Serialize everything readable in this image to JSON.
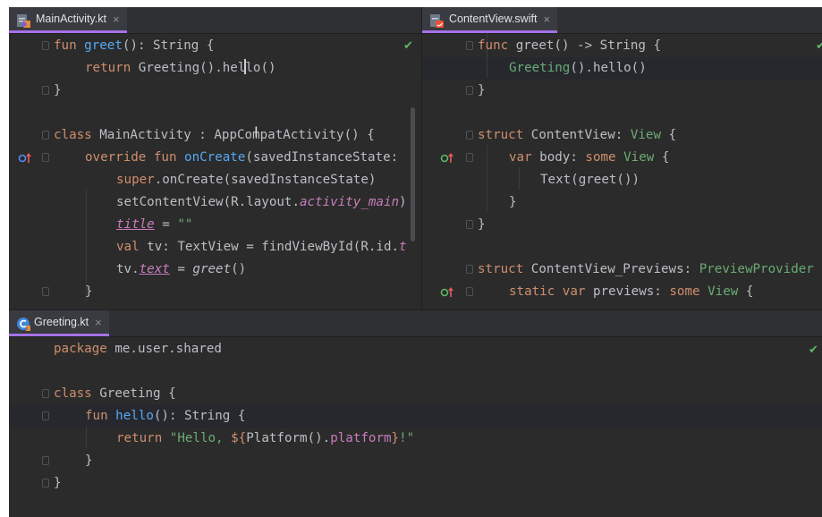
{
  "panes": {
    "main_activity": {
      "tab": {
        "label": "MainActivity.kt",
        "close": "×"
      },
      "lines": {
        "l1": {
          "kw": "fun ",
          "fn": "greet",
          "rest": "(): String {"
        },
        "l2": {
          "kw": "return ",
          "rest": "Greeting().hel",
          "rest2": "lo()"
        },
        "l3": {
          "rest": "}"
        },
        "l5": {
          "kw": "class ",
          "rest": "MainActivity : AppCompatActivity() {"
        },
        "l6": {
          "kw": "override fun ",
          "fn": "onCreate",
          "rest": "(savedInstanceState:"
        },
        "l7": {
          "kw": "super",
          "rest": ".onCreate(savedInstanceState)"
        },
        "l8": {
          "rest": "setContentView(R.layout.",
          "italic": "activity_main",
          "rest2": ")"
        },
        "l9": {
          "prop": "title",
          "rest": " = ",
          "str": "\"\""
        },
        "l10": {
          "kw": "val ",
          "rest": "tv: TextView = findViewById(R.id.",
          "italic": "t"
        },
        "l11": {
          "rest": "tv.",
          "prop": "text",
          "rest2": " = ",
          "italic": "greet",
          "rest3": "()"
        },
        "l12": {
          "rest": "}"
        }
      }
    },
    "content_view": {
      "tab": {
        "label": "ContentView.swift",
        "close": "×"
      },
      "lines": {
        "l1": {
          "kw": "func ",
          "rest": "greet() -> String {"
        },
        "l2": {
          "ty": "Greeting",
          "rest": "().hello()"
        },
        "l3": {
          "rest": "}"
        },
        "l5": {
          "kw": "struct ",
          "rest": "ContentView: ",
          "ty": "View",
          "rest2": " {"
        },
        "l6": {
          "kw": "var ",
          "rest": "body: ",
          "kw2": "some ",
          "ty": "View",
          "rest2": " {"
        },
        "l7": {
          "rest": "Text(greet())"
        },
        "l8": {
          "rest": "}"
        },
        "l9": {
          "rest": "}"
        },
        "l11": {
          "kw": "struct ",
          "rest": "ContentView_Previews: ",
          "ty": "PreviewProvider"
        },
        "l12": {
          "kw": "static var ",
          "rest": "previews: ",
          "kw2": "some ",
          "ty": "View",
          "rest2": " {"
        }
      }
    },
    "greeting": {
      "tab": {
        "label": "Greeting.kt",
        "close": "×"
      },
      "lines": {
        "l1": {
          "kw": "package ",
          "rest": "me.user.shared"
        },
        "l3": {
          "kw": "class ",
          "rest": "Greeting {"
        },
        "l4": {
          "kw": "fun ",
          "fn": "hello",
          "rest": "(): String {"
        },
        "l5": {
          "kw": "return ",
          "str": "\"Hello, ",
          "tmpl": "${",
          "rest": "Platform().",
          "prop": "platform",
          "tmpl2": "}",
          "str2": "!\""
        },
        "l6": {
          "rest": "}"
        },
        "l7": {
          "rest": "}"
        }
      }
    }
  },
  "icons": {
    "kotlin_file": "kotlin-file-icon",
    "swift_file": "swift-file-icon",
    "greeting_file": "kotlin-class-icon",
    "check": "✔",
    "override_marker": "override-gutter-icon"
  },
  "colors": {
    "editor_bg": "#2b2b2b",
    "keyword": "#cf8e6d",
    "function": "#56a8f5",
    "string": "#6aab73",
    "property": "#c77dbb",
    "text": "#bcbec4",
    "active_tab_underline": "#a571e6",
    "check": "#5fb865"
  }
}
